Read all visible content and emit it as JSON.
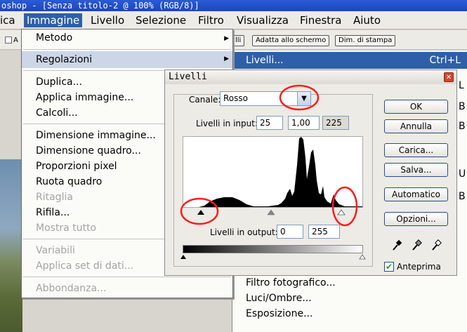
{
  "window": {
    "title": "oshop - [Senza titolo-2 @ 100% (RGB/8)]"
  },
  "menubar": [
    {
      "label": "ica"
    },
    {
      "label": "Immagine"
    },
    {
      "label": "Livello"
    },
    {
      "label": "Selezione"
    },
    {
      "label": "Filtro"
    },
    {
      "label": "Visualizza"
    },
    {
      "label": "Finestra"
    },
    {
      "label": "Aiuto"
    }
  ],
  "options_bar": {
    "buttons": [
      "lli",
      "Adatta allo schermo",
      "Dim. di stampa"
    ],
    "checkbox_label": "A"
  },
  "immagine_menu": {
    "items": [
      {
        "label": "Metodo",
        "disabled": false,
        "submenu": true
      },
      {
        "label": "Regolazioni",
        "disabled": false,
        "submenu": true,
        "highlighted": true
      },
      {
        "label": "Duplica...",
        "disabled": false
      },
      {
        "label": "Applica immagine...",
        "disabled": false
      },
      {
        "label": "Calcoli...",
        "disabled": false
      },
      {
        "label": "Dimensione immagine...",
        "disabled": false
      },
      {
        "label": "Dimensione quadro...",
        "disabled": false
      },
      {
        "label": "Proporzioni pixel",
        "disabled": false
      },
      {
        "label": "Ruota quadro",
        "disabled": false
      },
      {
        "label": "Ritaglia",
        "disabled": true
      },
      {
        "label": "Rifila...",
        "disabled": false
      },
      {
        "label": "Mostra tutto",
        "disabled": true
      },
      {
        "label": "Variabili",
        "disabled": true
      },
      {
        "label": "Applica set di dati...",
        "disabled": true
      },
      {
        "label": "Abbondanza...",
        "disabled": true
      }
    ]
  },
  "regolazioni_submenu": {
    "highlighted": {
      "label": "Livelli...",
      "shortcut": "Ctrl+L"
    },
    "visible_items": [
      "Filtro fotografico...",
      "Luci/Ombre...",
      "Esposizione..."
    ],
    "edge_letters": [
      "L",
      "B",
      "B",
      "U",
      "B"
    ]
  },
  "levels_dialog": {
    "title": "Livelli",
    "close_glyph": "✕",
    "channel_label": "Canale:",
    "channel_value": "Rosso",
    "input_levels_label": "Livelli in input:",
    "input_levels": [
      "25",
      "1,00",
      "225"
    ],
    "output_levels_label": "Livelli in output:",
    "output_levels": [
      "0",
      "255"
    ],
    "buttons": {
      "ok": "OK",
      "cancel": "Annulla",
      "load": "Carica...",
      "save": "Salva...",
      "auto": "Automatico",
      "options": "Opzioni..."
    },
    "preview_label": "Anteprima",
    "preview_checked": true
  },
  "colors": {
    "menu_highlight": "#2f5fa8",
    "annotation": "#ff1a1a",
    "title_bar": "#2a5bd7"
  }
}
